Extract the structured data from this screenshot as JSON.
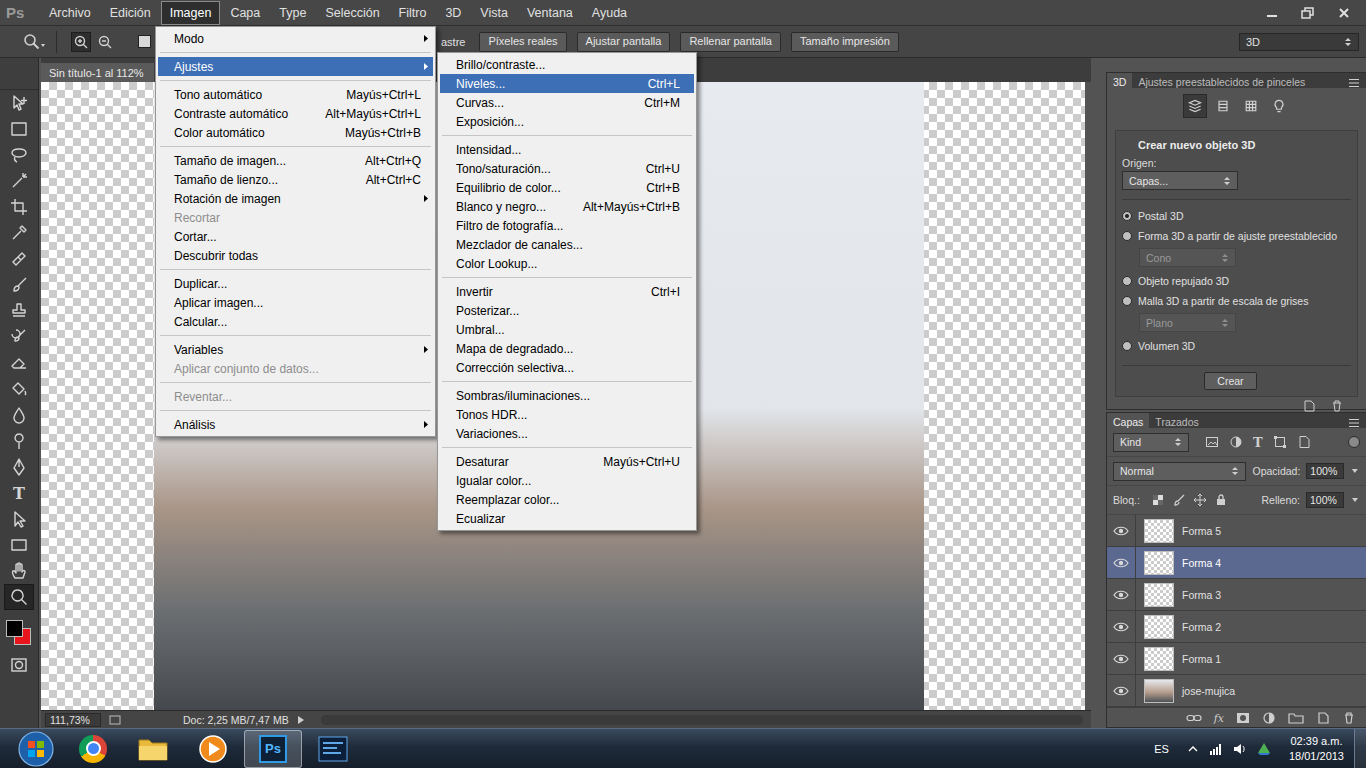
{
  "app": {
    "logo": "Ps"
  },
  "menu_bar": [
    {
      "label": "Archivo",
      "selected": false
    },
    {
      "label": "Edición",
      "selected": false
    },
    {
      "label": "Imagen",
      "selected": true
    },
    {
      "label": "Capa",
      "selected": false
    },
    {
      "label": "Type",
      "selected": false
    },
    {
      "label": "Selección",
      "selected": false
    },
    {
      "label": "Filtro",
      "selected": false
    },
    {
      "label": "3D",
      "selected": false
    },
    {
      "label": "Vista",
      "selected": false
    },
    {
      "label": "Ventana",
      "selected": false
    },
    {
      "label": "Ayuda",
      "selected": false
    }
  ],
  "options_bar": {
    "zoom_in_selected": true,
    "zoom_out_selected": false,
    "checkbox_checked": false,
    "covered_label": "astre",
    "buttons": [
      "Píxeles reales",
      "Ajustar pantalla",
      "Rellenar pantalla",
      "Tamaño impresión"
    ],
    "workspace": "3D"
  },
  "document": {
    "tab_title": "Sin título-1 al 112%",
    "zoom": "111,73%",
    "doc_info": "Doc: 2,25 MB/7,47 MB"
  },
  "tools": [
    {
      "kind": "icon",
      "selected": false
    },
    {
      "kind": "icon",
      "selected": false
    },
    {
      "kind": "icon",
      "selected": false
    },
    {
      "kind": "icon",
      "selected": false
    },
    {
      "kind": "icon",
      "selected": false
    },
    {
      "kind": "icon",
      "selected": false
    },
    {
      "kind": "icon",
      "selected": false
    },
    {
      "kind": "icon",
      "selected": false
    },
    {
      "kind": "icon",
      "selected": false
    },
    {
      "kind": "icon",
      "selected": false
    },
    {
      "kind": "icon",
      "selected": false
    },
    {
      "kind": "icon",
      "selected": false
    },
    {
      "kind": "icon",
      "selected": false
    },
    {
      "kind": "icon",
      "selected": false
    },
    {
      "kind": "icon",
      "selected": false
    },
    {
      "kind": "text",
      "glyph": "T",
      "selected": false
    },
    {
      "kind": "icon",
      "selected": false
    },
    {
      "kind": "icon",
      "selected": false
    },
    {
      "kind": "icon",
      "selected": false
    },
    {
      "kind": "icon",
      "selected": true
    }
  ],
  "colors": {
    "foreground": "#000000",
    "background": "#e8161c"
  },
  "image_menu": [
    {
      "kind": "item",
      "label": "Modo",
      "submenu": true,
      "disabled": false,
      "selected": false
    },
    {
      "kind": "separator"
    },
    {
      "kind": "item",
      "label": "Ajustes",
      "submenu": true,
      "disabled": false,
      "selected": true
    },
    {
      "kind": "separator"
    },
    {
      "kind": "item",
      "label": "Tono automático",
      "shortcut": "Mayús+Ctrl+L",
      "submenu": false,
      "disabled": false,
      "selected": false
    },
    {
      "kind": "item",
      "label": "Contraste automático",
      "shortcut": "Alt+Mayús+Ctrl+L",
      "submenu": false,
      "disabled": false,
      "selected": false
    },
    {
      "kind": "item",
      "label": "Color automático",
      "shortcut": "Mayús+Ctrl+B",
      "submenu": false,
      "disabled": false,
      "selected": false
    },
    {
      "kind": "separator"
    },
    {
      "kind": "item",
      "label": "Tamaño de imagen...",
      "shortcut": "Alt+Ctrl+Q",
      "submenu": false,
      "disabled": false,
      "selected": false
    },
    {
      "kind": "item",
      "label": "Tamaño de lienzo...",
      "shortcut": "Alt+Ctrl+C",
      "submenu": false,
      "disabled": false,
      "selected": false
    },
    {
      "kind": "item",
      "label": "Rotación de imagen",
      "submenu": true,
      "disabled": false,
      "selected": false
    },
    {
      "kind": "item",
      "label": "Recortar",
      "submenu": false,
      "disabled": true,
      "selected": false
    },
    {
      "kind": "item",
      "label": "Cortar...",
      "submenu": false,
      "disabled": false,
      "selected": false
    },
    {
      "kind": "item",
      "label": "Descubrir todas",
      "submenu": false,
      "disabled": false,
      "selected": false
    },
    {
      "kind": "separator"
    },
    {
      "kind": "item",
      "label": "Duplicar...",
      "submenu": false,
      "disabled": false,
      "selected": false
    },
    {
      "kind": "item",
      "label": "Aplicar imagen...",
      "submenu": false,
      "disabled": false,
      "selected": false
    },
    {
      "kind": "item",
      "label": "Calcular...",
      "submenu": false,
      "disabled": false,
      "selected": false
    },
    {
      "kind": "separator"
    },
    {
      "kind": "item",
      "label": "Variables",
      "submenu": true,
      "disabled": false,
      "selected": false
    },
    {
      "kind": "item",
      "label": "Aplicar conjunto de datos...",
      "submenu": false,
      "disabled": true,
      "selected": false
    },
    {
      "kind": "separator"
    },
    {
      "kind": "item",
      "label": "Reventar...",
      "submenu": false,
      "disabled": true,
      "selected": false
    },
    {
      "kind": "separator"
    },
    {
      "kind": "item",
      "label": "Análisis",
      "submenu": true,
      "disabled": false,
      "selected": false
    }
  ],
  "adjustments_menu": [
    {
      "kind": "item",
      "label": "Brillo/contraste...",
      "submenu": false,
      "disabled": false,
      "selected": false
    },
    {
      "kind": "item",
      "label": "Niveles...",
      "shortcut": "Ctrl+L",
      "submenu": false,
      "disabled": false,
      "selected": true
    },
    {
      "kind": "item",
      "label": "Curvas...",
      "shortcut": "Ctrl+M",
      "submenu": false,
      "disabled": false,
      "selected": false
    },
    {
      "kind": "item",
      "label": "Exposición...",
      "submenu": false,
      "disabled": false,
      "selected": false
    },
    {
      "kind": "separator"
    },
    {
      "kind": "item",
      "label": "Intensidad...",
      "submenu": false,
      "disabled": false,
      "selected": false
    },
    {
      "kind": "item",
      "label": "Tono/saturación...",
      "shortcut": "Ctrl+U",
      "submenu": false,
      "disabled": false,
      "selected": false
    },
    {
      "kind": "item",
      "label": "Equilibrio de color...",
      "shortcut": "Ctrl+B",
      "submenu": false,
      "disabled": false,
      "selected": false
    },
    {
      "kind": "item",
      "label": "Blanco y negro...",
      "shortcut": "Alt+Mayús+Ctrl+B",
      "submenu": false,
      "disabled": false,
      "selected": false
    },
    {
      "kind": "item",
      "label": "Filtro de fotografía...",
      "submenu": false,
      "disabled": false,
      "selected": false
    },
    {
      "kind": "item",
      "label": "Mezclador de canales...",
      "submenu": false,
      "disabled": false,
      "selected": false
    },
    {
      "kind": "item",
      "label": "Color Lookup...",
      "submenu": false,
      "disabled": false,
      "selected": false
    },
    {
      "kind": "separator"
    },
    {
      "kind": "item",
      "label": "Invertir",
      "shortcut": "Ctrl+I",
      "submenu": false,
      "disabled": false,
      "selected": false
    },
    {
      "kind": "item",
      "label": "Posterizar...",
      "submenu": false,
      "disabled": false,
      "selected": false
    },
    {
      "kind": "item",
      "label": "Umbral...",
      "submenu": false,
      "disabled": false,
      "selected": false
    },
    {
      "kind": "item",
      "label": "Mapa de degradado...",
      "submenu": false,
      "disabled": false,
      "selected": false
    },
    {
      "kind": "item",
      "label": "Corrección selectiva...",
      "submenu": false,
      "disabled": false,
      "selected": false
    },
    {
      "kind": "separator"
    },
    {
      "kind": "item",
      "label": "Sombras/iluminaciones...",
      "submenu": false,
      "disabled": false,
      "selected": false
    },
    {
      "kind": "item",
      "label": "Tonos HDR...",
      "submenu": false,
      "disabled": false,
      "selected": false
    },
    {
      "kind": "item",
      "label": "Variaciones...",
      "submenu": false,
      "disabled": false,
      "selected": false
    },
    {
      "kind": "separator"
    },
    {
      "kind": "item",
      "label": "Desaturar",
      "shortcut": "Mayús+Ctrl+U",
      "submenu": false,
      "disabled": false,
      "selected": false
    },
    {
      "kind": "item",
      "label": "Igualar color...",
      "submenu": false,
      "disabled": false,
      "selected": false
    },
    {
      "kind": "item",
      "label": "Reemplazar color...",
      "submenu": false,
      "disabled": false,
      "selected": false
    },
    {
      "kind": "item",
      "label": "Ecualizar",
      "submenu": false,
      "disabled": false,
      "selected": false
    }
  ],
  "panel_3d": {
    "tabs": [
      {
        "label": "3D",
        "selected": true
      },
      {
        "label": "Ajustes preestablecidos de pinceles",
        "selected": false
      }
    ],
    "modes": [
      {
        "selected": true
      },
      {
        "selected": false
      },
      {
        "selected": false
      },
      {
        "selected": false
      }
    ],
    "title": "Crear nuevo objeto 3D",
    "origin_label": "Origen:",
    "origin": "Capas...",
    "options": [
      {
        "kind": "radio",
        "label": "Postal 3D",
        "selected": true,
        "disabled": false
      },
      {
        "kind": "radio",
        "label": "Forma 3D a partir de ajuste preestablecido",
        "selected": false,
        "disabled": false
      },
      {
        "kind": "select",
        "label": "Cono",
        "selected": false,
        "disabled": true
      },
      {
        "kind": "radio",
        "label": "Objeto repujado 3D",
        "selected": false,
        "disabled": false
      },
      {
        "kind": "radio",
        "label": "Malla 3D a partir de escala de grises",
        "selected": false,
        "disabled": false
      },
      {
        "kind": "select",
        "label": "Plano",
        "selected": false,
        "disabled": true
      },
      {
        "kind": "radio",
        "label": "Volumen 3D",
        "selected": false,
        "disabled": false
      }
    ],
    "button": "Crear"
  },
  "layers_panel": {
    "tabs": [
      {
        "label": "Capas",
        "selected": true
      },
      {
        "label": "Trazados",
        "selected": false
      }
    ],
    "filter": "Kind",
    "text_filter_glyph": "T",
    "blend": "Normal",
    "opacity_label": "Opacidad:",
    "opacity": "100%",
    "lock_label": "Bloq.:",
    "fill_label": "Relleno:",
    "fill": "100%",
    "fx_glyph": "fx",
    "layers": [
      {
        "name": "Forma 5",
        "kind": "shape",
        "visible": true,
        "selected": false
      },
      {
        "name": "Forma 4",
        "kind": "shape",
        "visible": true,
        "selected": true
      },
      {
        "name": "Forma 3",
        "kind": "shape",
        "visible": true,
        "selected": false
      },
      {
        "name": "Forma 2",
        "kind": "shape",
        "visible": true,
        "selected": false
      },
      {
        "name": "Forma 1",
        "kind": "shape",
        "visible": true,
        "selected": false
      },
      {
        "name": "jose-mujica",
        "kind": "photo",
        "visible": true,
        "selected": false
      }
    ]
  },
  "taskbar": {
    "apps": [
      {
        "kind": "icon",
        "selected": false
      },
      {
        "kind": "icon",
        "selected": false
      },
      {
        "kind": "icon",
        "selected": false
      },
      {
        "kind": "label",
        "label": "Ps",
        "selected": true
      },
      {
        "kind": "icon",
        "selected": false
      }
    ],
    "language": "ES",
    "time": "02:39 a.m.",
    "date": "18/01/2013"
  }
}
